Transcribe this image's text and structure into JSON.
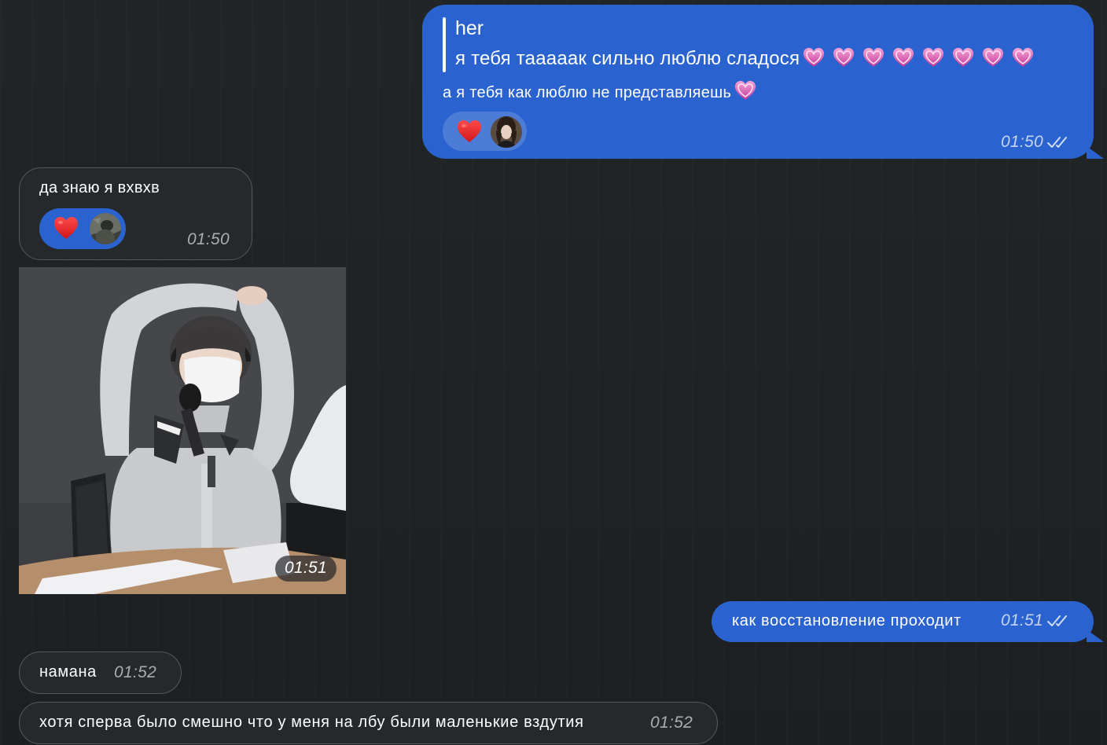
{
  "chat": {
    "messages": [
      {
        "direction": "outgoing",
        "quote_author": "her",
        "quote_text": "я тебя тааааак сильно люблю сладося",
        "quote_heart_count": 8,
        "text": "а я тебя как люблю не представляешь",
        "reaction": {
          "emoji": "red-heart",
          "avatar": "woman-avatar"
        },
        "time": "01:50",
        "status": "read"
      },
      {
        "direction": "incoming",
        "text": "да знаю я вхвхв",
        "reaction": {
          "emoji": "red-heart",
          "avatar": "man-avatar"
        },
        "time": "01:50"
      },
      {
        "direction": "incoming",
        "type": "photo",
        "time": "01:51"
      },
      {
        "direction": "outgoing",
        "text": "как восстановление проходит",
        "time": "01:51",
        "status": "read"
      },
      {
        "direction": "incoming",
        "text": "намана",
        "time": "01:52"
      },
      {
        "direction": "incoming",
        "text": "хотя сперва было смешно что у меня на лбу были маленькие вздутия",
        "time": "01:52"
      }
    ]
  },
  "colors": {
    "background": "#1f2225",
    "outgoing_bubble": "#2a63cf",
    "incoming_bubble": "#26292c",
    "incoming_border": "#54585c",
    "pink_heart": "#e05aa6"
  }
}
